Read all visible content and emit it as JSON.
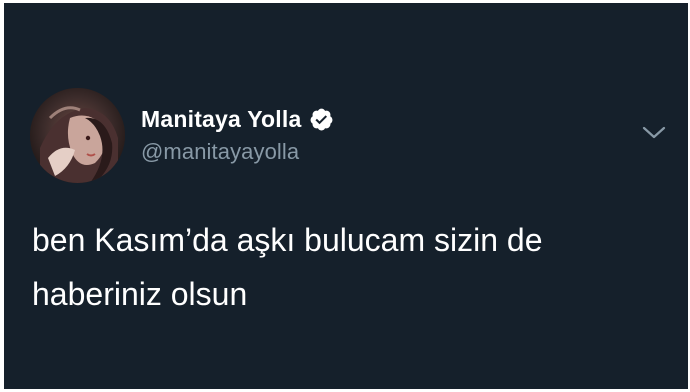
{
  "tweet": {
    "author": {
      "display_name": "Manitaya Yolla",
      "handle": "@manitayayolla",
      "verified": true,
      "avatar_icon": "avatar-image"
    },
    "text_lines": [
      "ben Kasım’da aşkı bulucam sizin de",
      "haberiniz olsun"
    ],
    "menu_icon": "chevron-down-icon"
  },
  "colors": {
    "background": "#15202b",
    "text_primary": "#ffffff",
    "text_secondary": "#8899a6"
  }
}
